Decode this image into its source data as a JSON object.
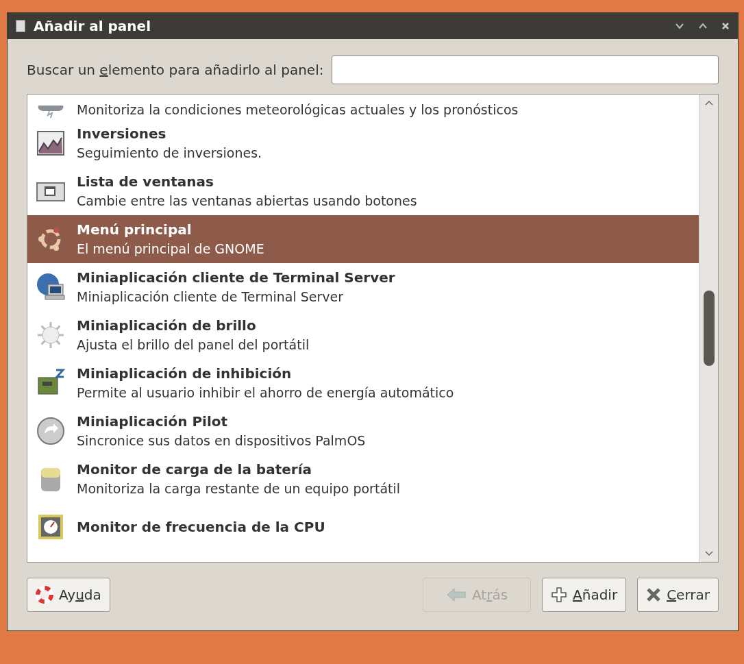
{
  "window": {
    "title": "Añadir al panel"
  },
  "search": {
    "label": {
      "before": "Buscar un ",
      "key": "e",
      "after": "lemento para añadirlo al panel:"
    }
  },
  "items": [
    {
      "kind": "weather",
      "description": "Monitoriza la condiciones meteorológicas actuales y los pronósticos",
      "selected": false
    },
    {
      "kind": "chart",
      "title": "Inversiones",
      "description": "Seguimiento de inversiones.",
      "selected": false
    },
    {
      "kind": "windows",
      "title": "Lista de ventanas",
      "description": "Cambie entre las ventanas abiertas usando botones",
      "selected": false
    },
    {
      "kind": "ubuntu",
      "title": "Menú principal",
      "description": "El menú principal de GNOME",
      "selected": true
    },
    {
      "kind": "terminal",
      "title": "Miniaplicación cliente de Terminal Server",
      "description": "Miniaplicación cliente de Terminal Server",
      "selected": false
    },
    {
      "kind": "brightness",
      "title": "Miniaplicación de brillo",
      "description": "Ajusta el brillo del panel del portátil",
      "selected": false
    },
    {
      "kind": "inhibit",
      "title": "Miniaplicación de inhibición",
      "description": "Permite al usuario inhibir el ahorro de energía automático",
      "selected": false
    },
    {
      "kind": "sync",
      "title": "Miniaplicación Pilot",
      "description": "Sincronice sus datos en dispositivos PalmOS",
      "selected": false
    },
    {
      "kind": "battery",
      "title": "Monitor de carga de la batería",
      "description": "Monitoriza la carga restante de un equipo portátil",
      "selected": false
    },
    {
      "kind": "cpu",
      "title": "Monitor de frecuencia de la CPU",
      "selected": false
    }
  ],
  "buttons": [
    {
      "kind": "help",
      "label": {
        "before": "Ay",
        "key": "u",
        "after": "da"
      },
      "disabled": false
    },
    {
      "kind": "back",
      "label": {
        "before": "At",
        "key": "r",
        "after": "ás"
      },
      "disabled": true
    },
    {
      "kind": "add",
      "label": {
        "key": "A",
        "after": "ñadir"
      },
      "disabled": false
    },
    {
      "kind": "close",
      "label": {
        "key": "C",
        "after": "errar"
      },
      "disabled": false
    }
  ]
}
